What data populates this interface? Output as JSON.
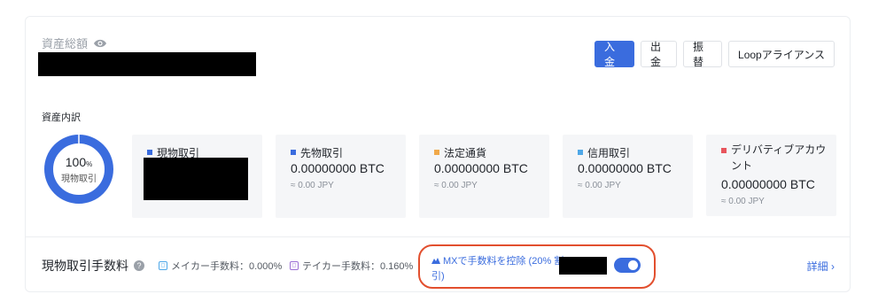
{
  "header": {
    "total_assets_label": "資産総額",
    "eye_icon": "eye-icon"
  },
  "actions": {
    "deposit": "入 金",
    "withdraw": "出 金",
    "transfer": "振 替",
    "loop": "Loopアライアンス"
  },
  "breakdown": {
    "label": "資産内訳",
    "donut_percent": "100",
    "donut_percent_unit": "%",
    "donut_caption": "現物取引"
  },
  "accounts": [
    {
      "name": "現物取引",
      "value": "",
      "approx": "",
      "color": "#3a6cde"
    },
    {
      "name": "先物取引",
      "value": "0.00000000 BTC",
      "approx": "≈ 0.00 JPY",
      "color": "#3a6cde"
    },
    {
      "name": "法定通貨",
      "value": "0.00000000 BTC",
      "approx": "≈ 0.00 JPY",
      "color": "#f0a94a"
    },
    {
      "name": "信用取引",
      "value": "0.00000000 BTC",
      "approx": "≈ 0.00 JPY",
      "color": "#4fa8e8"
    },
    {
      "name": "デリバティブアカウント",
      "value": "0.00000000 BTC",
      "approx": "≈ 0.00 JPY",
      "color": "#e8555d"
    }
  ],
  "fees": {
    "title": "現物取引手数料",
    "maker_label": "メイカー手数料：0.000%",
    "taker_label": "テイカー手数料：0.160%",
    "deduct_label": "MXで手数料を控除 (20% 割引)",
    "deduct_enabled": true,
    "details": "詳細 ›"
  },
  "colors": {
    "accent": "#3a6cde",
    "highlight": "#e24f2e"
  }
}
